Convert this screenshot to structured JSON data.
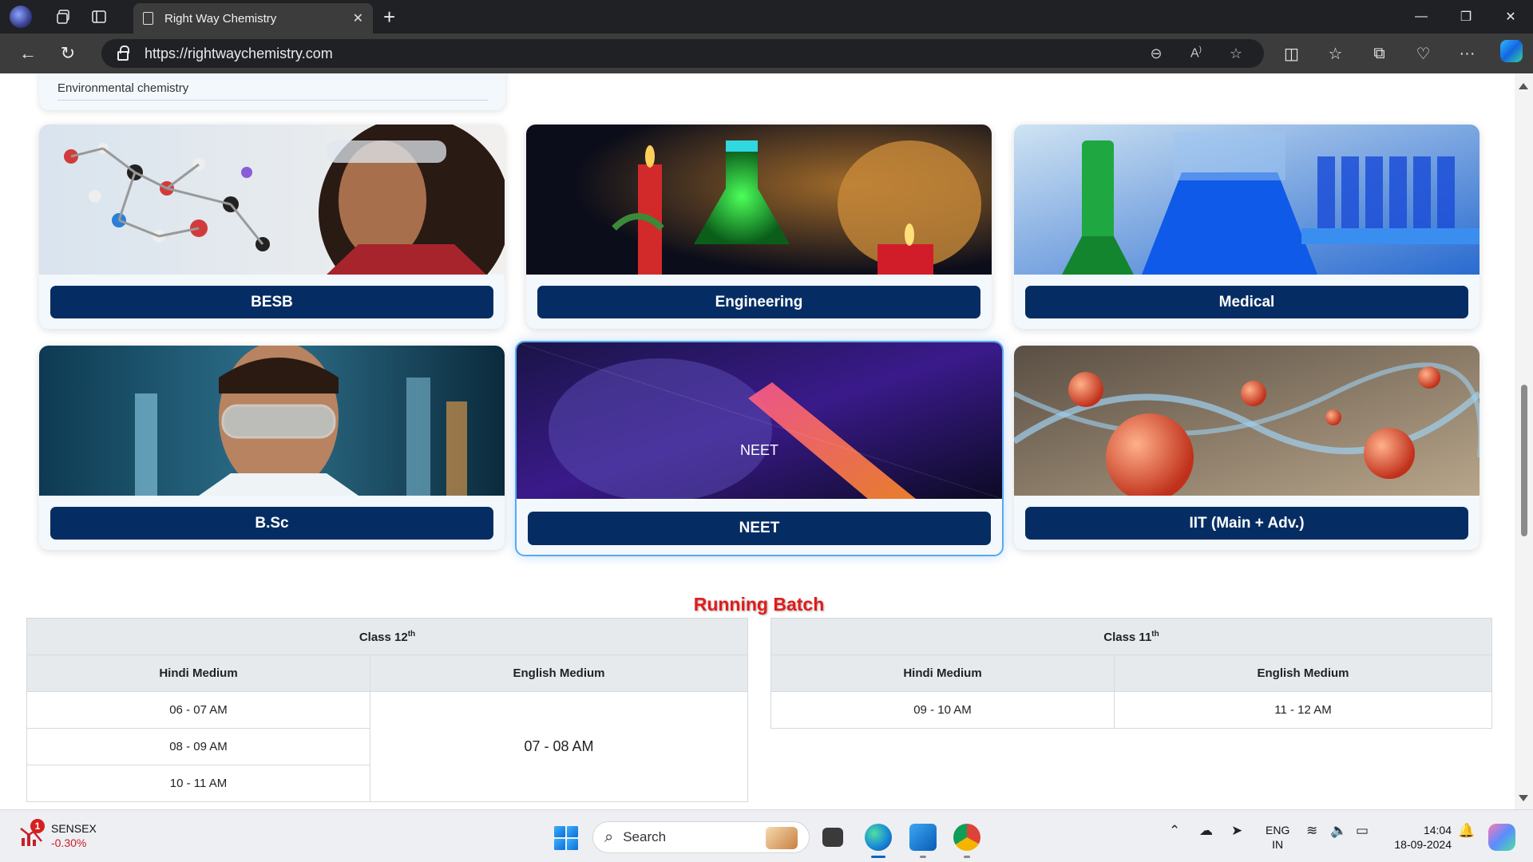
{
  "browser": {
    "tab_title": "Right Way Chemistry",
    "url": "https://rightwaychemistry.com"
  },
  "page": {
    "top_card_topic": "Environmental chemistry",
    "courses": [
      {
        "label": "BESB",
        "image": "molecule-model-student-photo"
      },
      {
        "label": "Engineering",
        "image": "flasks-and-candles-photo"
      },
      {
        "label": "Medical",
        "image": "blue-green-lab-glassware-photo"
      },
      {
        "label": "B.Sc",
        "image": "scientist-with-goggles-photo"
      },
      {
        "label": "NEET",
        "image": "glowing-test-tube-photo",
        "overlay_label": "NEET",
        "highlighted": true
      },
      {
        "label": "IIT (Main + Adv.)",
        "image": "orbital-spheres-photo"
      }
    ],
    "running_batch": {
      "title": "Running Batch",
      "class12": {
        "heading": "Class 12",
        "heading_sup": "th",
        "hindi_header": "Hindi Medium",
        "english_header": "English Medium",
        "hindi_times": [
          "06 - 07 AM",
          "08 - 09 AM",
          "10 - 11 AM"
        ],
        "english_time": "07 - 08 AM"
      },
      "class11": {
        "heading": "Class 11",
        "heading_sup": "th",
        "hindi_header": "Hindi Medium",
        "english_header": "English Medium",
        "hindi_time": "09 - 10 AM",
        "english_time": "11 - 12 AM"
      }
    }
  },
  "taskbar": {
    "widget_name": "SENSEX",
    "widget_change": "-0.30%",
    "widget_badge": "1",
    "search_placeholder": "Search",
    "lang_line1": "ENG",
    "lang_line2": "IN",
    "time": "14:04",
    "date": "18-09-2024"
  },
  "colors": {
    "button_navy": "#062d63",
    "batch_title_red": "#e21b1b",
    "card_bg": "#f3f8fd"
  }
}
